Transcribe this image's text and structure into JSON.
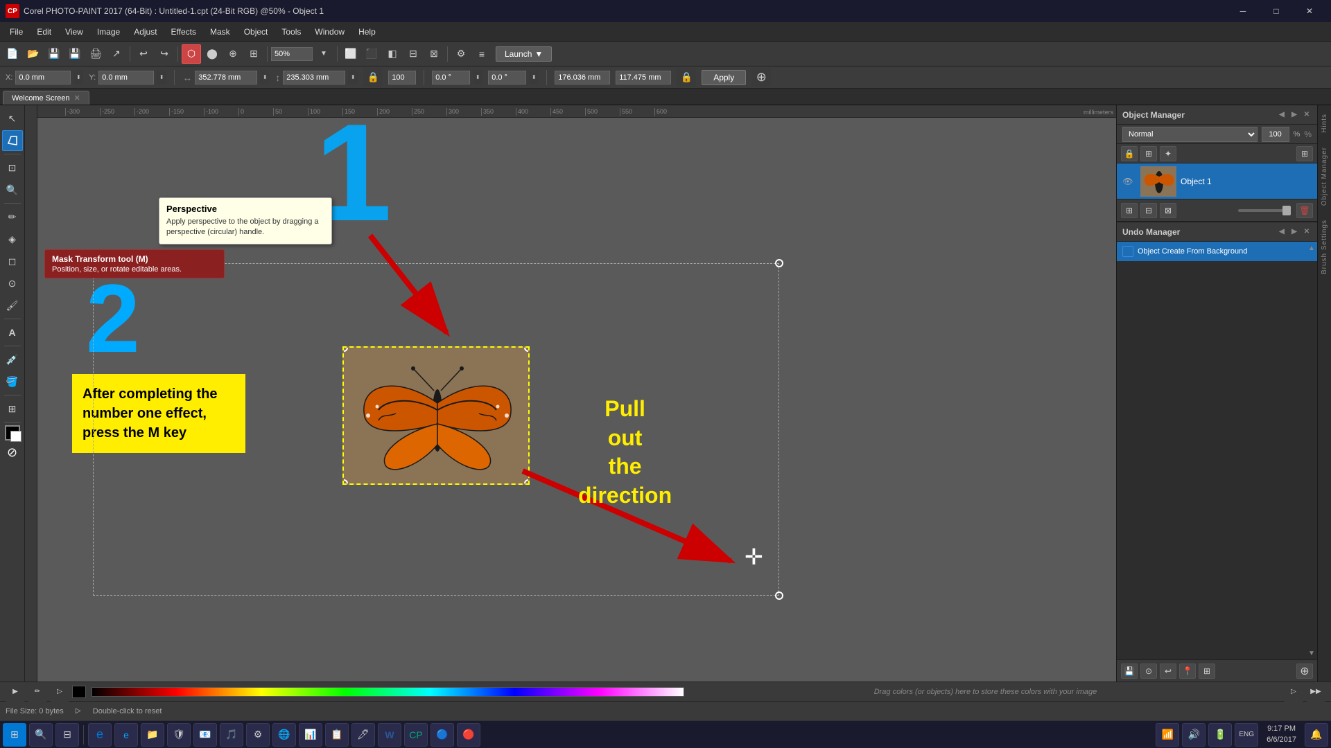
{
  "titlebar": {
    "title": "Corel PHOTO-PAINT 2017 (64-Bit) : Untitled-1.cpt (24-Bit RGB) @50% - Object 1",
    "icon": "CP"
  },
  "menubar": {
    "items": [
      "File",
      "Edit",
      "View",
      "Image",
      "Adjust",
      "Effects",
      "Mask",
      "Object",
      "Tools",
      "Window",
      "Help"
    ]
  },
  "toolbar": {
    "zoom_value": "50%",
    "launch_label": "Launch"
  },
  "optionsbar": {
    "x_label": "X:",
    "x_value": "0.0 mm",
    "y_label": "Y:",
    "y_value": "0.0 mm",
    "w_label": "W:",
    "w_value": "352.778 mm",
    "h_label": "H:",
    "h_value": "235.303 mm",
    "pct_value": "100",
    "rotation_value": "0.0 °",
    "rotation2_value": "0.0 °",
    "pos1_value": "176.036 mm",
    "pos2_value": "117.475 mm",
    "apply_label": "Apply"
  },
  "tooltip": {
    "title": "Perspective",
    "desc": "Apply perspective to the object by dragging a perspective (circular) handle."
  },
  "mask_tooltip": {
    "title": "Mask Transform tool (M)",
    "desc": "Position, size, or rotate editable areas."
  },
  "canvas": {
    "number1": "1",
    "number2": "2",
    "yellow_box_text": "After completing the number one effect, press the M key",
    "pull_text": "Pull\nout\nthe\ndirection"
  },
  "object_manager": {
    "title": "Object Manager",
    "blend_mode": "Normal",
    "opacity": "100",
    "pct": "%",
    "object1_name": "Object 1"
  },
  "undo_manager": {
    "title": "Undo Manager",
    "items": [
      {
        "label": "Object Create From Background",
        "active": true
      }
    ]
  },
  "statusbar": {
    "file_size": "File Size: 0 bytes",
    "hint": "Double-click to reset"
  },
  "colorbar": {
    "hint": "Drag colors (or objects) here to store these colors with your image"
  },
  "tabbar": {
    "tab": "Welcome Screen"
  },
  "taskbar": {
    "time": "9:17 PM",
    "date": "6/6/2017"
  },
  "hints": {
    "tab1": "Hints",
    "tab2": "Object Manager",
    "tab3": "Brush Settings"
  },
  "rulers": {
    "ticks": [
      "-300",
      "-250",
      "-200",
      "-150",
      "-100",
      "0",
      "50",
      "100",
      "150",
      "200",
      "250",
      "300",
      "350",
      "400",
      "450",
      "500",
      "550",
      "600"
    ],
    "unit": "millimeters"
  }
}
